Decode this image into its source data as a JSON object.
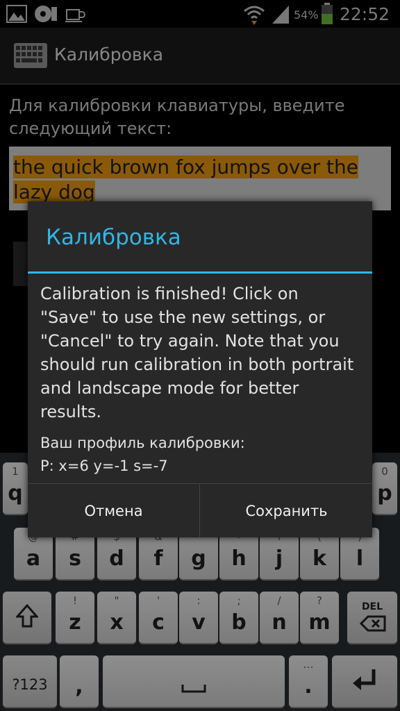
{
  "status_bar": {
    "battery_percent": "54%",
    "time": "22:52",
    "icons": [
      "gallery-icon",
      "sd-card-icon",
      "coffee-icon",
      "wifi-icon",
      "signal-icon",
      "battery-icon"
    ]
  },
  "action_bar": {
    "title": "Калибровка",
    "icon": "keyboard-icon"
  },
  "content": {
    "instruction": "Для калибровки клавиатуры, введите следующий текст:",
    "phrase": "the quick brown fox jumps over the lazy dog"
  },
  "dialog": {
    "title": "Калибровка",
    "message": "Calibration is finished! Click on \"Save\" to use the new settings, or \"Cancel\" to try again. Note that you should run calibration in both portrait and landscape mode for better results.",
    "profile_label": "Ваш профиль калибровки:",
    "profile_value": "P: x=6 y=-1 s=-7",
    "cancel_label": "Отмена",
    "save_label": "Сохранить",
    "accent_color": "#33b5e5"
  },
  "keyboard": {
    "row1_left": {
      "main": "q",
      "sub": "1"
    },
    "row1_right": {
      "main": "p",
      "sub": "0"
    },
    "row2": [
      {
        "main": "a",
        "sub": "@"
      },
      {
        "main": "s",
        "sub": "#"
      },
      {
        "main": "d",
        "sub": "$"
      },
      {
        "main": "f",
        "sub": "&"
      },
      {
        "main": "g",
        "sub": "*"
      },
      {
        "main": "h",
        "sub": "-"
      },
      {
        "main": "j",
        "sub": "+"
      },
      {
        "main": "k",
        "sub": "("
      },
      {
        "main": "l",
        "sub": ")"
      }
    ],
    "row3": [
      {
        "main": "z",
        "sub": "!"
      },
      {
        "main": "x",
        "sub": "\""
      },
      {
        "main": "c",
        "sub": "'"
      },
      {
        "main": "v",
        "sub": ":"
      },
      {
        "main": "b",
        "sub": ";"
      },
      {
        "main": "n",
        "sub": "/"
      },
      {
        "main": "m",
        "sub": "?"
      }
    ],
    "delete_label": "DEL",
    "symbols_label": "?123",
    "comma": ",",
    "period": ".",
    "period_sub": "…"
  }
}
